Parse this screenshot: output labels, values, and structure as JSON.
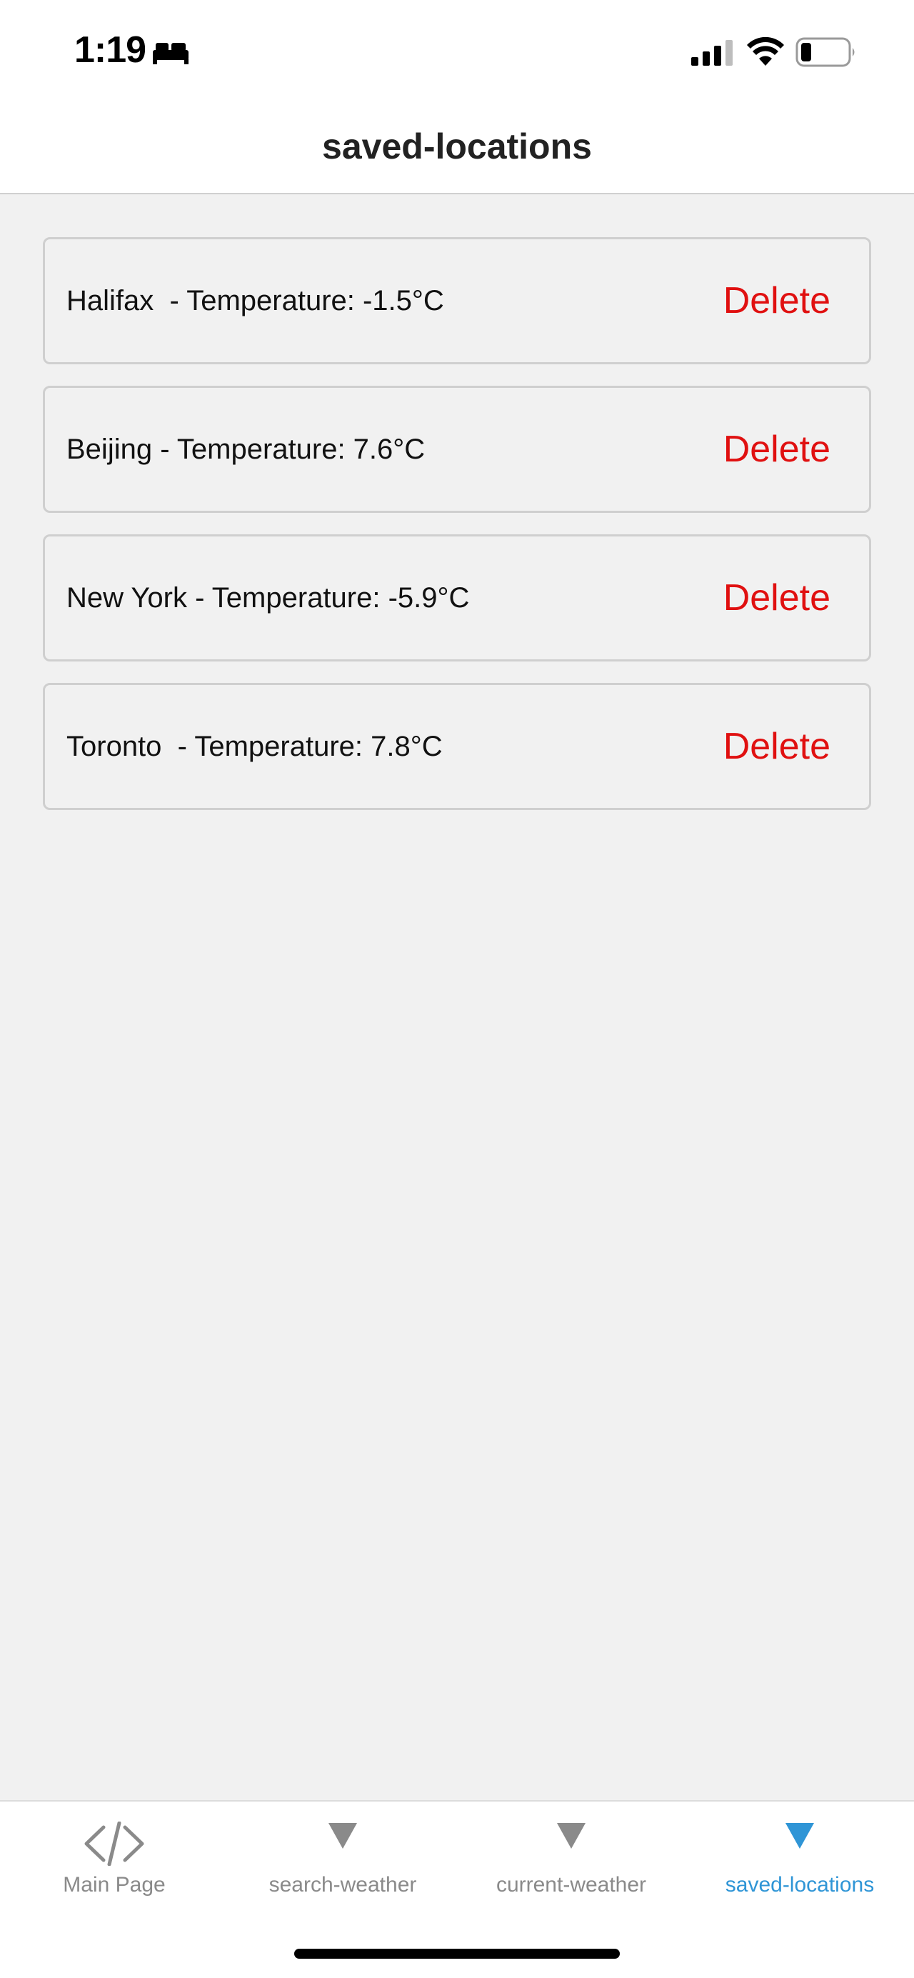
{
  "status_bar": {
    "time": "1:19",
    "icons": [
      "bed-icon",
      "cellular-signal-icon",
      "wifi-icon",
      "battery-icon"
    ]
  },
  "header": {
    "title": "saved-locations"
  },
  "locations": [
    {
      "label": "Halifax  - Temperature: -1.5°C",
      "action": "Delete"
    },
    {
      "label": "Beijing - Temperature: 7.6°C",
      "action": "Delete"
    },
    {
      "label": "New York - Temperature: -5.9°C",
      "action": "Delete"
    },
    {
      "label": "Toronto  - Temperature: 7.8°C",
      "action": "Delete"
    }
  ],
  "tab_bar": {
    "tabs": [
      {
        "label": "Main Page",
        "icon": "code-icon",
        "active": false
      },
      {
        "label": "search-weather",
        "icon": "triangle-down-icon",
        "active": false
      },
      {
        "label": "current-weather",
        "icon": "triangle-down-icon",
        "active": false
      },
      {
        "label": "saved-locations",
        "icon": "triangle-down-icon",
        "active": true
      }
    ]
  },
  "colors": {
    "delete": "#e01010",
    "active_tab": "#2f95d6",
    "inactive_tab": "#8a8a8a",
    "background": "#f1f1f1"
  }
}
